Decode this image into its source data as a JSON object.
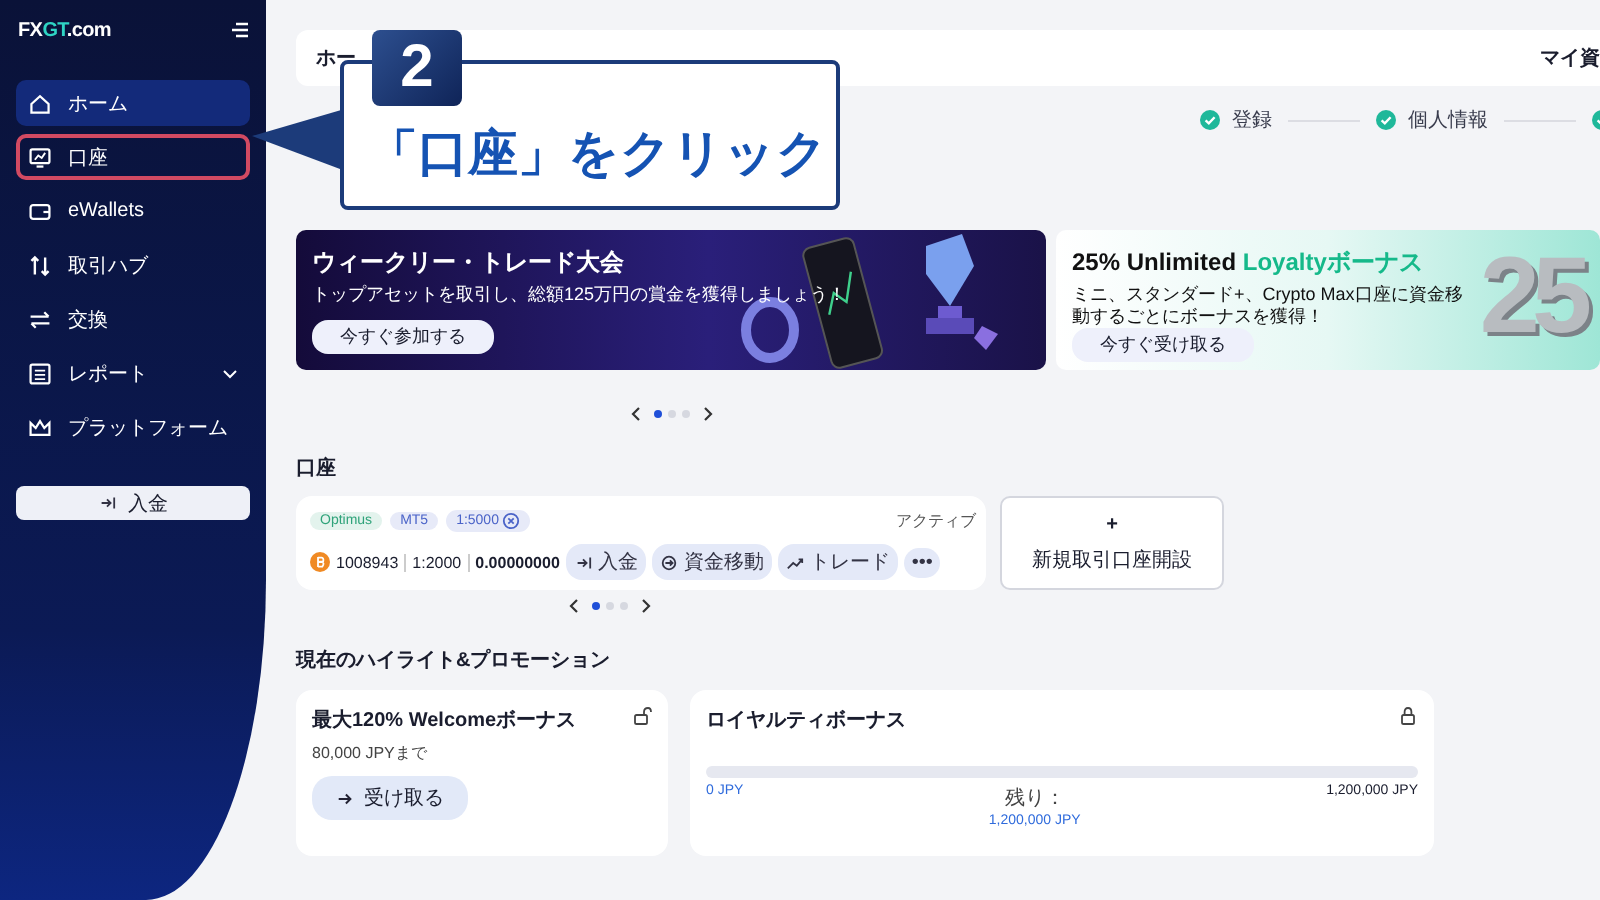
{
  "sidebar": {
    "logo": {
      "brand": "FX",
      "accent": "GT",
      "suffix": ".com"
    },
    "items": [
      {
        "label": "ホーム",
        "selected": true,
        "outlined": false,
        "expandable": false
      },
      {
        "label": "口座",
        "selected": false,
        "outlined": true,
        "expandable": false
      },
      {
        "label": "eWallets",
        "selected": false,
        "outlined": false,
        "expandable": false
      },
      {
        "label": "取引ハブ",
        "selected": false,
        "outlined": false,
        "expandable": false
      },
      {
        "label": "交換",
        "selected": false,
        "outlined": false,
        "expandable": false
      },
      {
        "label": "レポート",
        "selected": false,
        "outlined": false,
        "expandable": true
      },
      {
        "label": "プラットフォーム",
        "selected": false,
        "outlined": false,
        "expandable": false
      }
    ],
    "deposit_button": "入金"
  },
  "header": {
    "title": "ホー",
    "right": "マイ資"
  },
  "steps": [
    {
      "label": "登録",
      "done": true
    },
    {
      "label": "個人情報",
      "done": true
    },
    {
      "done": true
    }
  ],
  "banners": [
    {
      "title": "ウィークリー・トレード大会",
      "subtitle": "トップアセットを取引し、総額125万円の賞金を獲得しましょう！",
      "button": "今すぐ参加する"
    },
    {
      "title": "25% Unlimited ",
      "title_accent": "Loyaltyボーナス",
      "subtitle": "ミニ、スタンダード+、Crypto Max口座に資金移動するごとにボーナスを獲得！",
      "button": "今すぐ受け取る",
      "art_text": "25"
    }
  ],
  "banner_pager": [
    {
      "selected": true
    },
    {
      "selected": false
    },
    {
      "selected": false
    }
  ],
  "accounts": {
    "heading": "口座",
    "account": {
      "tags": [
        {
          "label": "Optimus",
          "color": "#2fa37a"
        },
        {
          "label": "MT5",
          "color": "#4a63c8"
        },
        {
          "label": "1:5000",
          "color": "#4a63c8"
        }
      ],
      "status": "アクティブ",
      "number": "1008943",
      "leverage": "1:2000",
      "balance": "0.00000000",
      "actions": [
        "入金",
        "資金移動",
        "トレード"
      ],
      "more": "•••"
    },
    "new_account": {
      "plus": "+",
      "label": "新規取引口座開設"
    },
    "pager": [
      {
        "selected": true
      },
      {
        "selected": false
      },
      {
        "selected": false
      }
    ]
  },
  "promotions": {
    "heading": "現在のハイライト&プロモーション",
    "welcome": {
      "title": "最大120% Welcomeボーナス",
      "subtitle": "80,000 JPYまで",
      "button": "受け取る"
    },
    "loyalty": {
      "title": "ロイヤルティボーナス",
      "level": 0,
      "start": "0 JPY",
      "remaining_label": "残り：",
      "remaining": "1,200,000 JPY",
      "end": "1,200,000 JPY"
    }
  },
  "callout": {
    "number": "2",
    "text": "「口座」をクリック"
  }
}
